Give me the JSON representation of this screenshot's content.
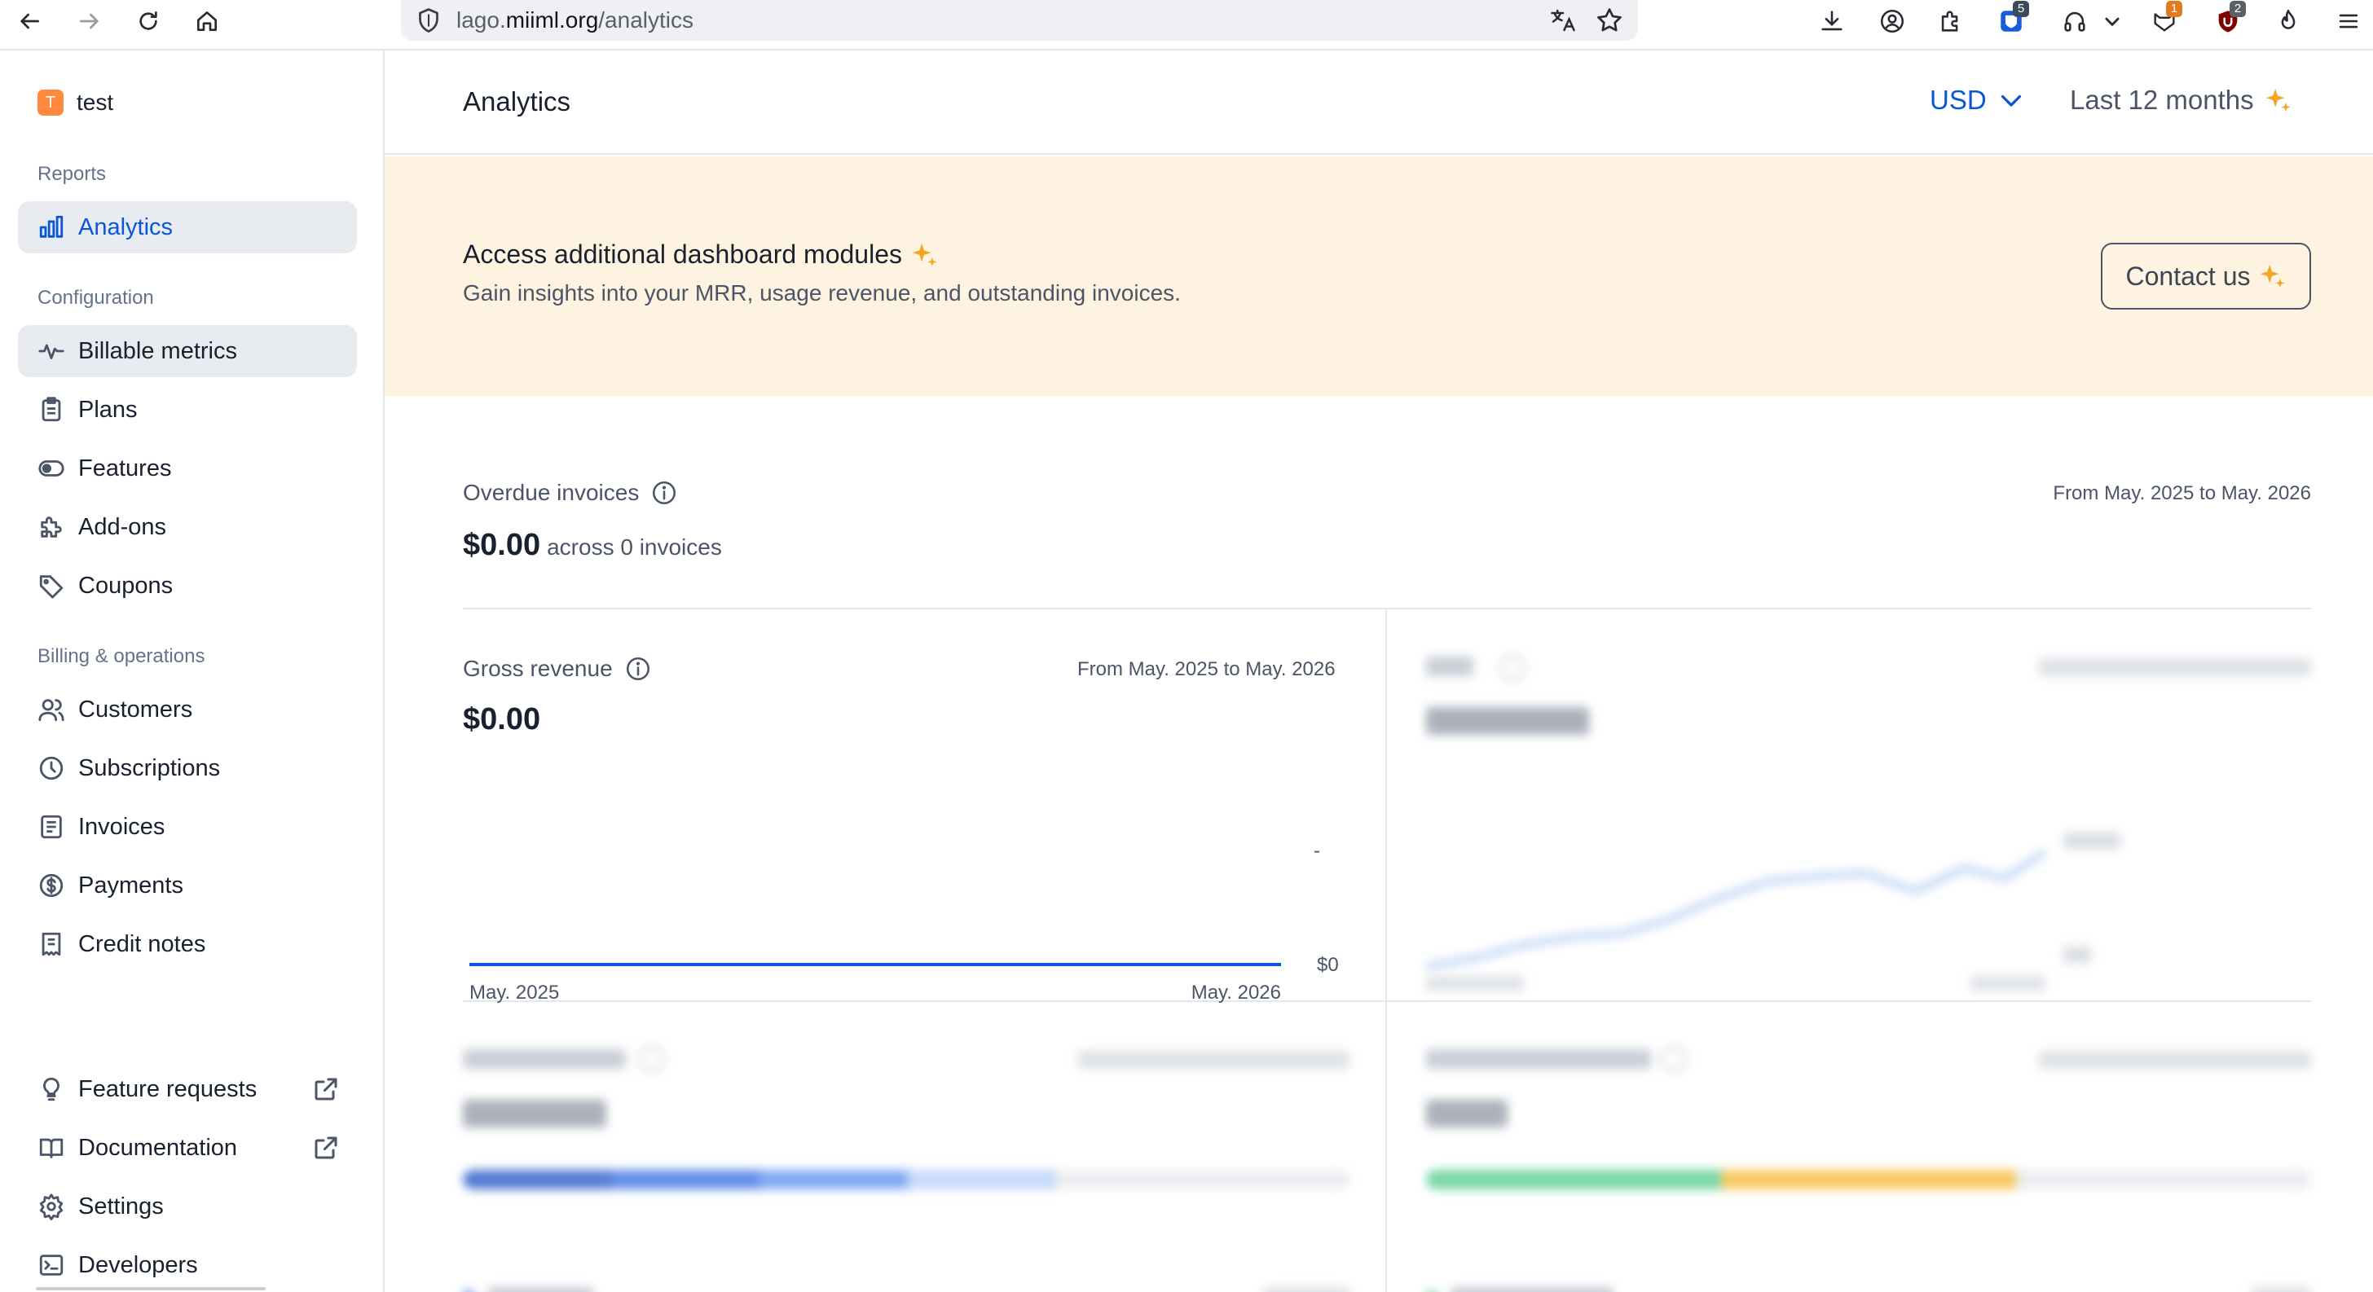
{
  "browser": {
    "url_prefix": "lago.",
    "url_domain": "miiml.org",
    "url_path": "/analytics",
    "ext_badges": [
      "5",
      "1",
      "2"
    ]
  },
  "sidebar": {
    "org_initial": "T",
    "org_name": "test",
    "sections": {
      "reports": "Reports",
      "configuration": "Configuration",
      "billing": "Billing & operations"
    },
    "items": {
      "analytics": "Analytics",
      "billable_metrics": "Billable metrics",
      "plans": "Plans",
      "features": "Features",
      "addons": "Add-ons",
      "coupons": "Coupons",
      "customers": "Customers",
      "subscriptions": "Subscriptions",
      "invoices": "Invoices",
      "payments": "Payments",
      "credit_notes": "Credit notes",
      "feature_requests": "Feature requests",
      "documentation": "Documentation",
      "settings": "Settings",
      "developers": "Developers"
    }
  },
  "header": {
    "title": "Analytics",
    "currency": "USD",
    "period": "Last 12 months"
  },
  "banner": {
    "title": "Access additional dashboard modules",
    "subtitle": "Gain insights into your MRR, usage revenue, and outstanding invoices.",
    "button": "Contact us"
  },
  "overdue": {
    "title": "Overdue invoices",
    "range": "From May. 2025 to May. 2026",
    "amount": "$0.00",
    "across": "across 0 invoices"
  },
  "gross": {
    "title": "Gross revenue",
    "range": "From May. 2025 to May. 2026",
    "amount": "$0.00",
    "y_top": "-",
    "y_bottom": "$0",
    "x_start": "May. 2025",
    "x_end": "May. 2026"
  },
  "colors": {
    "accent": "#0a56d6",
    "banner_bg": "#fef3e1",
    "sparkle": "#f5a524",
    "success": "#4cc98a"
  },
  "chart_data": {
    "type": "line",
    "title": "Gross revenue",
    "x": [
      "May. 2025",
      "May. 2026"
    ],
    "series": [
      {
        "values": [
          0,
          0
        ]
      }
    ]
  }
}
